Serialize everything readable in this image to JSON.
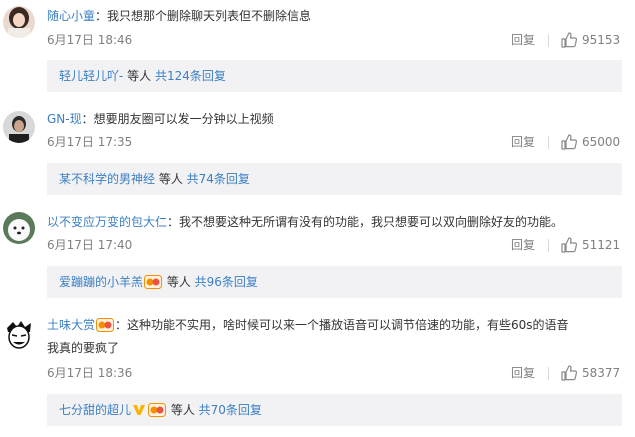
{
  "comments": [
    {
      "name": "随心小童",
      "sep": "：",
      "text": "我只想那个删除聊天列表但不删除信息",
      "date": "6月17日 18:46",
      "reply": "回复",
      "likes": "95153",
      "sub": {
        "names": "轻儿轻儿吖-",
        "etc": " 等人 ",
        "count": "共124条回复"
      }
    },
    {
      "name": "GN-现",
      "sep": "：",
      "text": "想要朋友圈可以发一分钟以上视频",
      "date": "6月17日 17:35",
      "reply": "回复",
      "likes": "65000",
      "sub": {
        "names": "某不科学的男神经",
        "etc": " 等人 ",
        "count": "共74条回复"
      }
    },
    {
      "name": "以不变应万变的包大仁",
      "sep": "：",
      "text": "我不想要这种无所谓有没有的功能，我只想要可以双向删除好友的功能。",
      "date": "6月17日 17:40",
      "reply": "回复",
      "likes": "51121",
      "sub": {
        "names": "爱蹦蹦的小羊羔",
        "etc": " 等人 ",
        "count": "共96条回复"
      }
    },
    {
      "name": "土味大赏",
      "sep": "：",
      "text": "这种功能不实用，啥时候可以来一个播放语音可以调节倍速的功能，有些60s的语音",
      "text2": "我真的要疯了",
      "date": "6月17日 18:36",
      "reply": "回复",
      "likes": "58377",
      "sub": {
        "names": "七分甜的超儿",
        "etc": " 等人 ",
        "count": "共70条回复"
      }
    }
  ],
  "icons": {
    "like": "thumbs-up-icon",
    "fan_badge": "fan-club-badge-icon",
    "v_badge": "gold-v-badge-icon"
  },
  "colors": {
    "name": "#3b7fc4",
    "meta": "#808080",
    "sub_bg": "#f2f2f5",
    "badge_orange": "#f79000"
  }
}
